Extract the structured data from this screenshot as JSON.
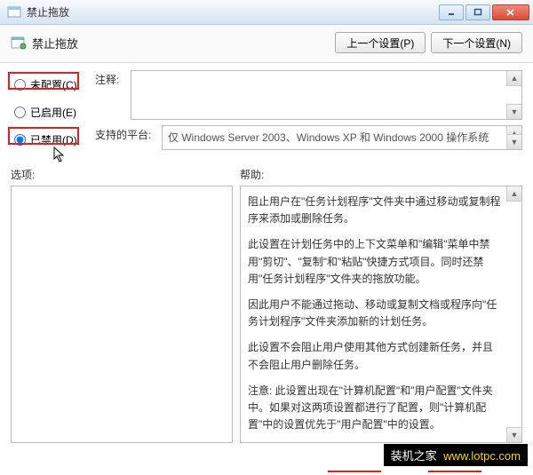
{
  "window": {
    "title": "禁止拖放",
    "min_tip": "最小化",
    "max_tip": "最大化",
    "close_tip": "关闭"
  },
  "header": {
    "title": "禁止拖放",
    "prev_btn": "上一个设置(P)",
    "next_btn": "下一个设置(N)"
  },
  "radios": {
    "not_configured": "未配置(C)",
    "enabled": "已启用(E)",
    "disabled": "已禁用(D)"
  },
  "comment": {
    "label": "注释:"
  },
  "platform": {
    "label": "支持的平台:",
    "value": "仅 Windows Server 2003、Windows XP 和 Windows 2000 操作系统"
  },
  "lower": {
    "options_label": "选项:",
    "help_label": "帮助:"
  },
  "help": {
    "p1": "阻止用户在\"任务计划程序\"文件夹中通过移动或复制程序来添加或删除任务。",
    "p2": "此设置在计划任务中的上下文菜单和\"编辑\"菜单中禁用\"剪切\"、\"复制\"和\"粘贴\"快捷方式项目。同时还禁用\"任务计划程序\"文件夹的拖放功能。",
    "p3": "因此用户不能通过拖动、移动或复制文档或程序向\"任务计划程序\"文件夹添加新的计划任务。",
    "p4": "此设置不会阻止用户使用其他方式创建新任务，并且不会阻止用户删除任务。",
    "p5": "注意: 此设置出现在\"计算机配置\"和\"用户配置\"文件夹中。如果对这两项设置都进行了配置，则\"计算机配置\"中的设置优先于\"用户配置\"中的设置。"
  },
  "watermark": {
    "cn": "装机之家",
    "url": "www.lotpc.com"
  }
}
